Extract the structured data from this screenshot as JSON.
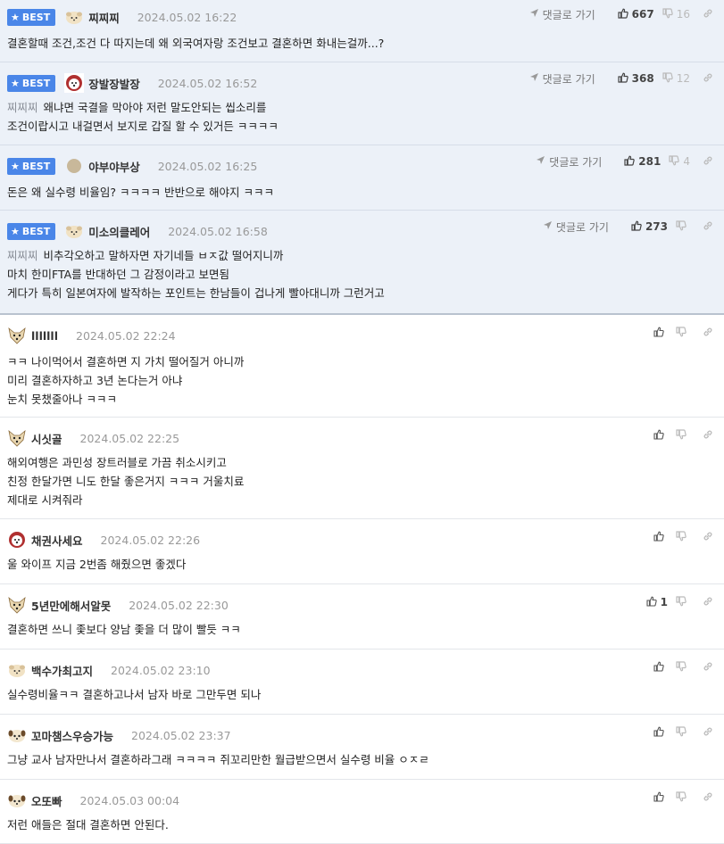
{
  "labels": {
    "best": "BEST",
    "reply_link": "댓글로 가기"
  },
  "colors": {
    "best_badge": "#4a86e8",
    "best_bg": "#ecf1f8"
  },
  "comments": [
    {
      "best": true,
      "avatar": "blob-dog",
      "nick": "찌찌찌",
      "date": "2024.05.02 16:22",
      "mention": "",
      "lines": [
        "결혼할때 조건,조건 다 따지는데 왜 외국여자랑 조건보고 결혼하면 화내는걸까...?"
      ],
      "up": "667",
      "down": "16"
    },
    {
      "best": true,
      "avatar": "red-dog",
      "nick": "장발장발장",
      "date": "2024.05.02 16:52",
      "mention": "찌찌찌",
      "lines": [
        "왜냐면 국결을 막아야 저런 말도안되는 씹소리를",
        "조건이랍시고 내걸면서 보지로 갑질 할 수 있거든 ㅋㅋㅋㅋ"
      ],
      "up": "368",
      "down": "12"
    },
    {
      "best": true,
      "avatar": "circle",
      "nick": "야부야부상",
      "date": "2024.05.02 16:25",
      "mention": "",
      "lines": [
        "돈은 왜 실수령 비율임? ㅋㅋㅋㅋ 반반으로 해야지 ㅋㅋㅋ"
      ],
      "up": "281",
      "down": "4"
    },
    {
      "best": true,
      "avatar": "blob-dog",
      "nick": "미소의클레어",
      "date": "2024.05.02 16:58",
      "mention": "찌찌찌",
      "lines": [
        "비추각오하고 말하자면 자기네들 ㅂㅈ값 떨어지니까",
        "마치 한미FTA를 반대하던 그 감정이라고 보면됨",
        "게다가 특히 일본여자에 발작하는 포인트는 한남들이 겁나게 빨아대니까 그런거고"
      ],
      "up": "273",
      "down": ""
    },
    {
      "best": false,
      "avatar": "fox",
      "nick": "lllllll",
      "date": "2024.05.02 22:24",
      "mention": "",
      "lines": [
        "ㅋㅋ 나이먹어서 결혼하면 지 가치 떨어질거 아니까",
        "미리 결혼하자하고 3년 논다는거 아냐",
        "눈치 못챘줄아나 ㅋㅋㅋ"
      ],
      "up": "",
      "down": ""
    },
    {
      "best": false,
      "avatar": "fox",
      "nick": "시싯골",
      "date": "2024.05.02 22:25",
      "mention": "",
      "lines": [
        "해외여행은 과민성 장트러블로 가끔 취소시키고",
        "친정 한달가면 니도 한달 좋은거지 ㅋㅋㅋ 거울치료",
        "제대로 시켜줘라"
      ],
      "up": "",
      "down": ""
    },
    {
      "best": false,
      "avatar": "red-dog",
      "nick": "채권사세요",
      "date": "2024.05.02 22:26",
      "mention": "",
      "lines": [
        "울 와이프 지금 2번좀 해줬으면 좋겠다"
      ],
      "up": "",
      "down": ""
    },
    {
      "best": false,
      "avatar": "fox",
      "nick": "5년만에해서알못",
      "date": "2024.05.02 22:30",
      "mention": "",
      "lines": [
        "결혼하면 쓰니 좇보다 양남 좇을 더 많이 빨듯 ㅋㅋ"
      ],
      "up": "1",
      "down": ""
    },
    {
      "best": false,
      "avatar": "blob-dog",
      "nick": "백수가최고지",
      "date": "2024.05.02 23:10",
      "mention": "",
      "lines": [
        "실수령비율ㅋㅋ 결혼하고나서 남자 바로 그만두면 되나"
      ],
      "up": "",
      "down": ""
    },
    {
      "best": false,
      "avatar": "puppy",
      "nick": "꼬마챔스우승가능",
      "date": "2024.05.02 23:37",
      "mention": "",
      "lines": [
        "그냥 교사 남자만나서 결혼하라그래 ㅋㅋㅋㅋ 쥐꼬리만한 월급받으면서 실수령 비율 ㅇㅈㄹ"
      ],
      "up": "",
      "down": ""
    },
    {
      "best": false,
      "avatar": "puppy",
      "nick": "오또빠",
      "date": "2024.05.03 00:04",
      "mention": "",
      "lines": [
        "저런 애들은 절대 결혼하면 안된다."
      ],
      "up": "",
      "down": ""
    }
  ]
}
